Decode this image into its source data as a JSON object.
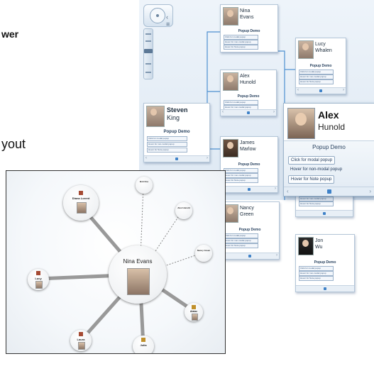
{
  "fragments": {
    "wer": "wer",
    "yout": "yout"
  },
  "orgchart": {
    "nav_grip": "‹ ≡",
    "popup_title": "Popup Demo",
    "links": [
      "Click for modal popup",
      "Hover for non-modal popup",
      "Hover for Note popup"
    ],
    "footer_prev": "‹",
    "footer_next": "›",
    "cards": [
      {
        "first": "Nina",
        "last": "Evans"
      },
      {
        "first": "Lucy",
        "last": "Whalen"
      },
      {
        "first": "Alex",
        "last": "Hunold"
      },
      {
        "first": "Steven",
        "last": "King"
      },
      {
        "first": "James",
        "last": "Marlow"
      },
      {
        "first": "Nancy",
        "last": "Green"
      },
      {
        "first": "Jon",
        "last": "Wu"
      }
    ],
    "expanded": {
      "first": "Alex",
      "last": "Hunold",
      "popup_title": "Popup Demo",
      "buttons": [
        "Click for modal popup",
        "Hover for non-modal popup",
        "Hover for Note popup"
      ]
    }
  },
  "radial": {
    "center": "Nina Evans",
    "nodes": {
      "diana": "Diana Lorent",
      "bob": "Bob Doe",
      "alex": "Alex Hunold",
      "nancy": "Nancy Green",
      "lucy": "Lucy",
      "alaiac": "Alaiac",
      "laura": "Laura",
      "julia": "Julia"
    }
  },
  "colors": {
    "tag": "#a54a33",
    "tag_gold": "#c0902a",
    "accent": "#3f82c8"
  }
}
